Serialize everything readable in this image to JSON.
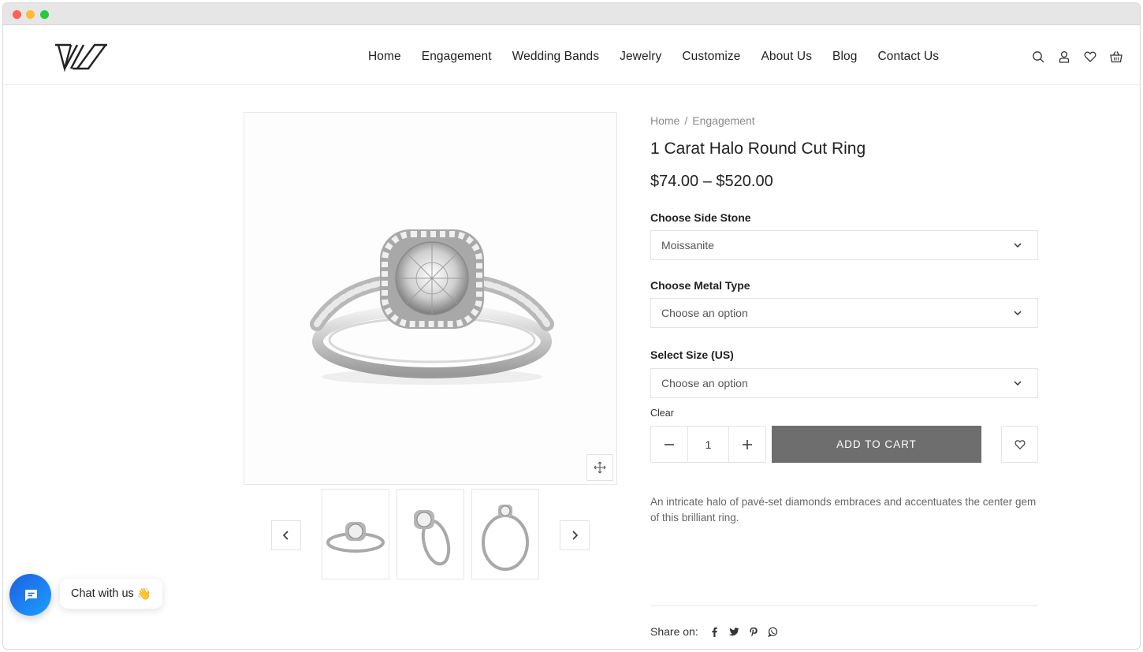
{
  "nav": {
    "items": [
      "Home",
      "Engagement",
      "Wedding Bands",
      "Jewelry",
      "Customize",
      "About Us",
      "Blog",
      "Contact Us"
    ]
  },
  "header_icons": [
    "search-icon",
    "user-icon",
    "heart-icon",
    "basket-icon"
  ],
  "breadcrumb": {
    "home": "Home",
    "separator": "/",
    "current": "Engagement"
  },
  "product": {
    "title": "1 Carat Halo Round Cut Ring",
    "price": "$74.00 – $520.00",
    "description": "An intricate halo of pavé-set diamonds embraces and accentuates the center gem of this brilliant ring."
  },
  "options": {
    "side_stone": {
      "label": "Choose Side Stone",
      "value": "Moissanite"
    },
    "metal_type": {
      "label": "Choose Metal Type",
      "value": "Choose an option"
    },
    "size": {
      "label": "Select Size (US)",
      "value": "Choose an option"
    },
    "clear_label": "Clear"
  },
  "cart": {
    "quantity": "1",
    "add_to_cart_label": "ADD TO CART"
  },
  "share": {
    "label": "Share on:",
    "networks": [
      "facebook-icon",
      "twitter-icon",
      "pinterest-icon",
      "whatsapp-icon"
    ]
  },
  "chat": {
    "label": "Chat with us",
    "emoji": "👋"
  },
  "colors": {
    "cart_button": "#6e6e6e",
    "chat_gradient_start": "#1f5fe0",
    "chat_gradient_end": "#1aa0ff"
  }
}
